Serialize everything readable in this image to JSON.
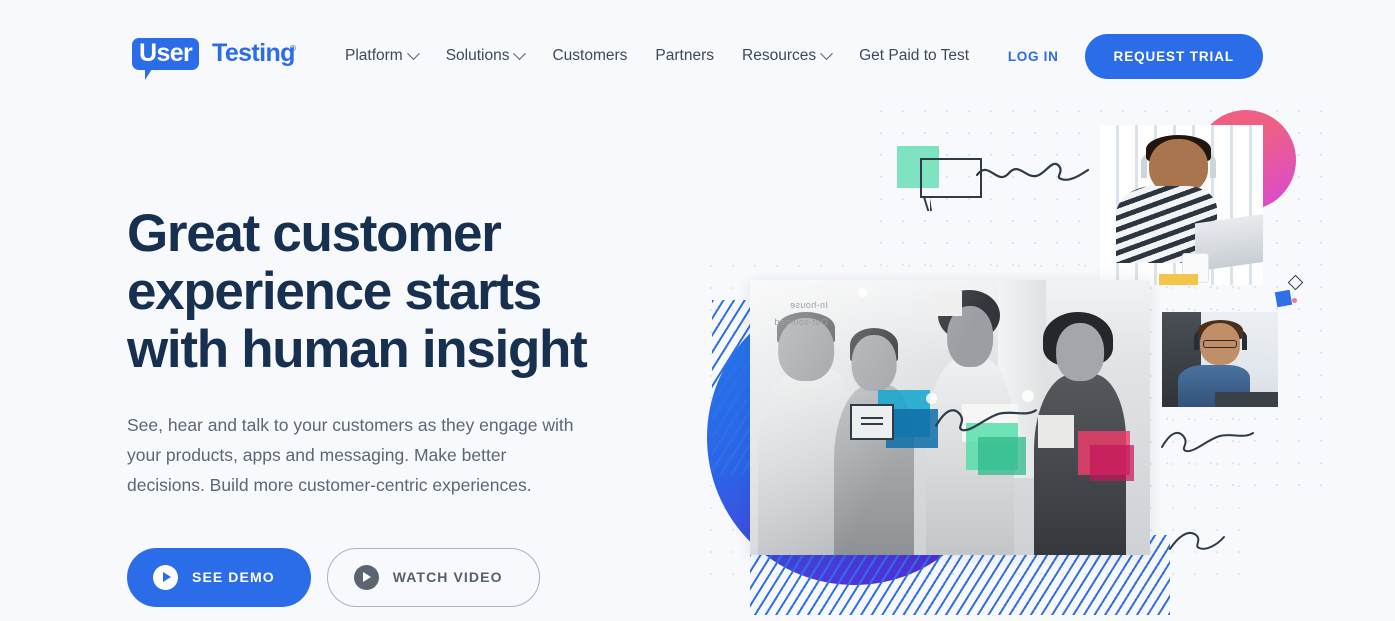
{
  "brand": {
    "logo_badge_text": "User",
    "logo_word_text": "Testing",
    "logo_registered": "®",
    "accent_blue": "#2b6ce8",
    "headline_navy": "#18304f",
    "body_gray": "#5b6776",
    "page_background": "#f7f9fc"
  },
  "nav": {
    "items": [
      {
        "label": "Platform",
        "has_dropdown": true
      },
      {
        "label": "Solutions",
        "has_dropdown": true
      },
      {
        "label": "Customers",
        "has_dropdown": false
      },
      {
        "label": "Partners",
        "has_dropdown": false
      },
      {
        "label": "Resources",
        "has_dropdown": true
      },
      {
        "label": "Get Paid to Test",
        "has_dropdown": false
      }
    ],
    "login_label": "LOG IN",
    "trial_label": "REQUEST TRIAL"
  },
  "hero": {
    "headline_line1": "Great customer",
    "headline_line2": "experience starts",
    "headline_line3": "with human insight",
    "subcopy": "See, hear and talk to your customers as they engage with your products, apps and messaging. Make better decisions. Build more customer-centric experiences.",
    "cta_primary": "SEE DEMO",
    "cta_secondary": "WATCH VIDEO"
  },
  "collage": {
    "whiteboard_text_line1": "In-house",
    "whiteboard_text_line2": "Out-sourced",
    "shapes": {
      "pink_circle_gradient_from": "#f0617e",
      "pink_circle_gradient_to": "#d748d8",
      "blue_circle_gradient_from": "#1f7bea",
      "blue_circle_gradient_to": "#5c1fd0",
      "mint_square": "#7fe3c1",
      "hatch_line_color": "#2f6fe8",
      "small_square": "#2f6fe8",
      "small_dot": "#ef7a96"
    },
    "sticky_note_colors": [
      "#18a7cf",
      "#4ddca6",
      "#ef3d6b"
    ],
    "photos": [
      {
        "name": "woman-on-phone"
      },
      {
        "name": "man-with-headphones-laptop"
      },
      {
        "name": "bearded-man-headshot"
      },
      {
        "name": "team-collaboration-group"
      }
    ]
  }
}
